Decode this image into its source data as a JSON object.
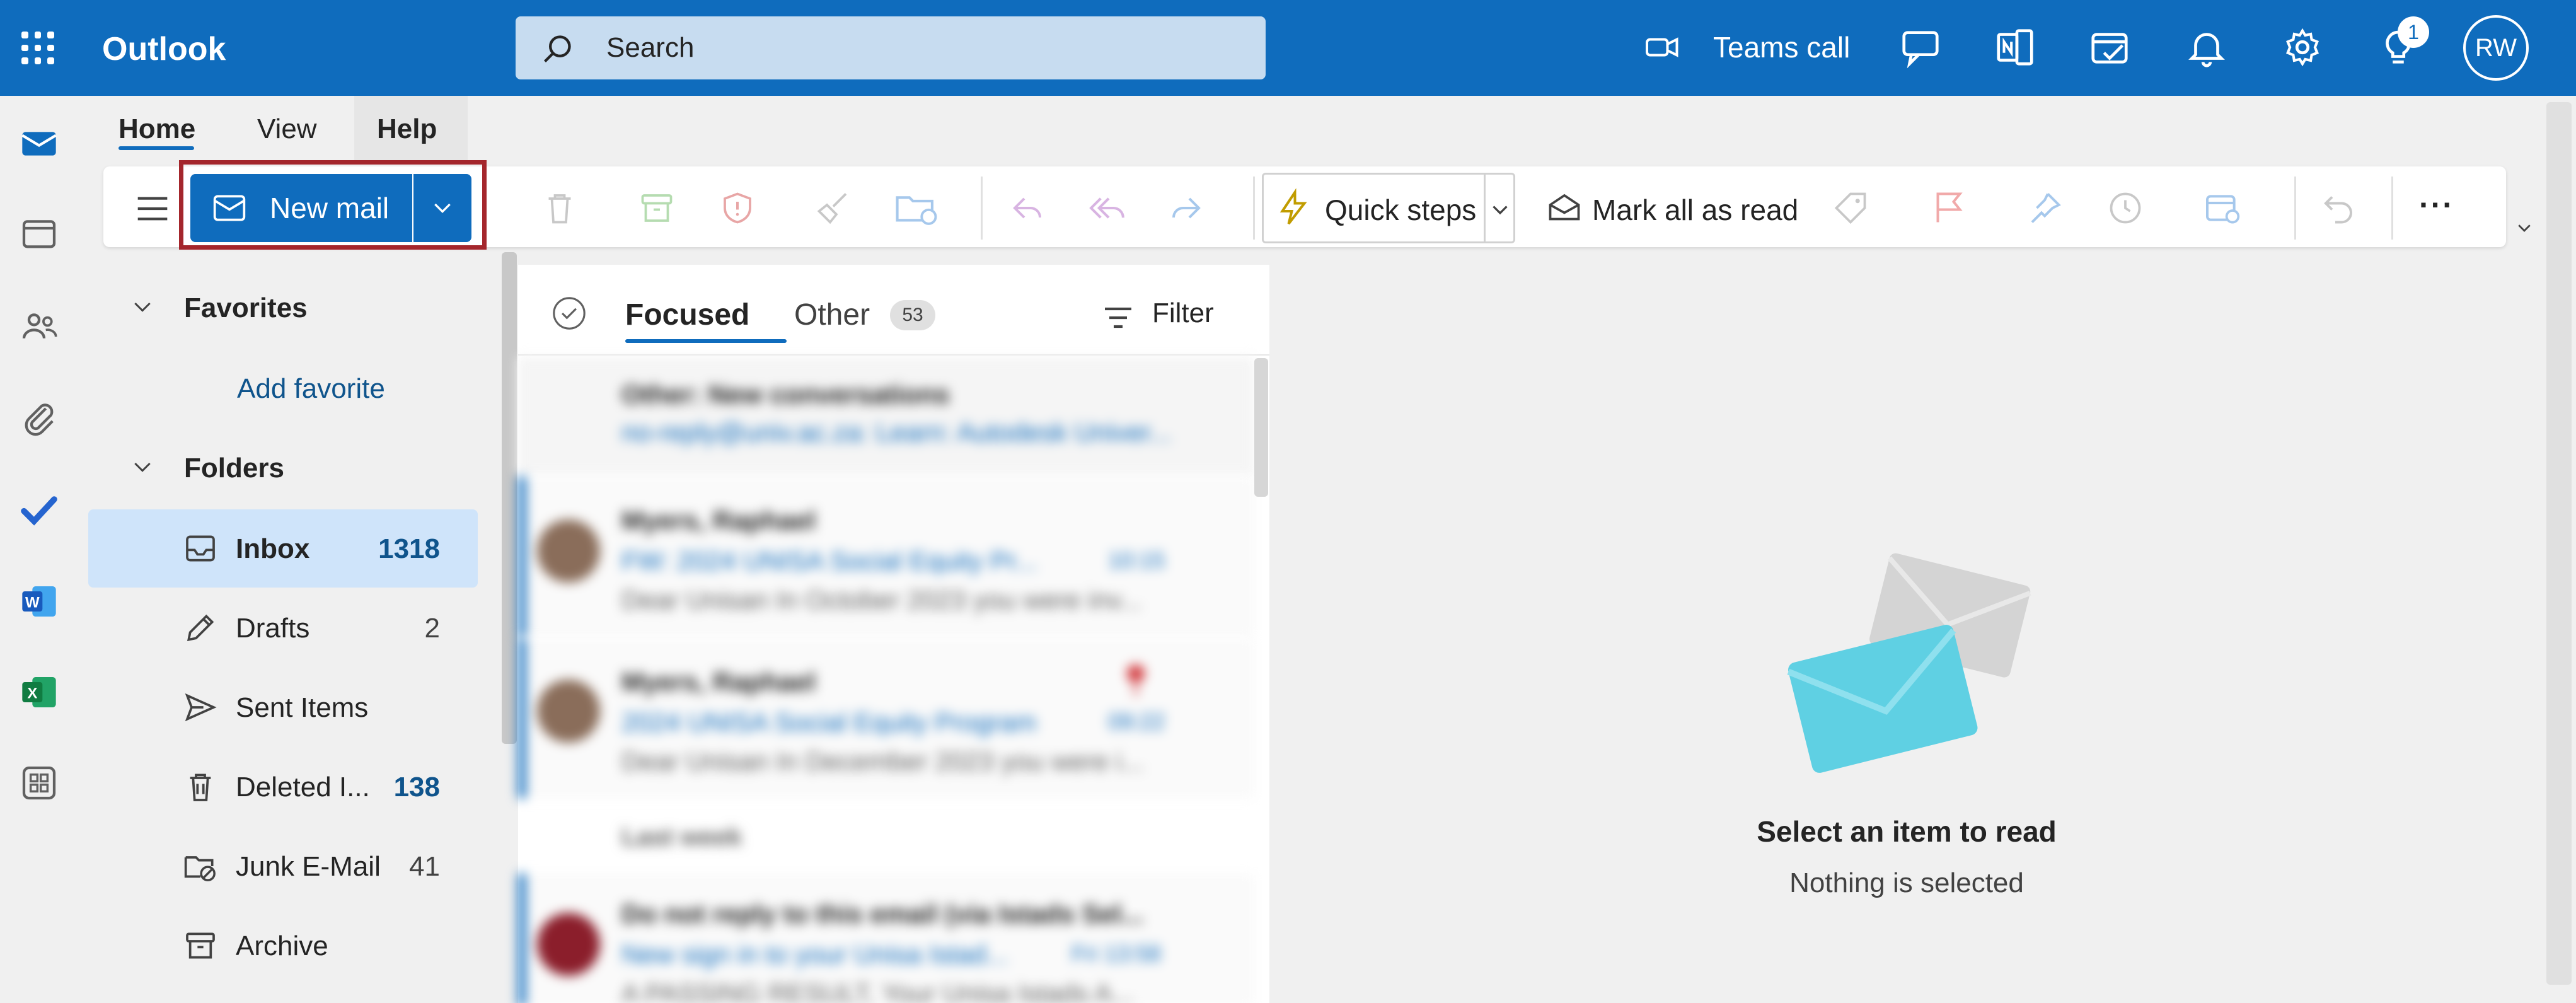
{
  "app": {
    "name": "Outlook"
  },
  "search": {
    "placeholder": "Search"
  },
  "topbar": {
    "teams_call": "Teams call",
    "tips_count": "1",
    "avatar_initials": "RW"
  },
  "ribbon": {
    "tabs": [
      {
        "label": "Home"
      },
      {
        "label": "View"
      },
      {
        "label": "Help"
      }
    ],
    "new_mail": "New mail",
    "quick_steps": "Quick steps",
    "mark_all_read": "Mark all as read",
    "more": "···"
  },
  "folder_pane": {
    "favorites": "Favorites",
    "add_favorite": "Add favorite",
    "folders": "Folders",
    "items": [
      {
        "name": "Inbox",
        "count": "1318"
      },
      {
        "name": "Drafts",
        "count": "2"
      },
      {
        "name": "Sent Items",
        "count": ""
      },
      {
        "name": "Deleted I...",
        "count": "138"
      },
      {
        "name": "Junk E-Mail",
        "count": "41"
      },
      {
        "name": "Archive",
        "count": ""
      }
    ]
  },
  "message_list": {
    "focused": "Focused",
    "other": "Other",
    "other_count": "53",
    "filter": "Filter",
    "messages": [
      {
        "l1": "Other: New conversations",
        "l2": "no-reply@univ.ac.za: Learn: Autodesk Univer..."
      },
      {
        "l1": "Myers, Raphael",
        "l2": "FW: 2024 UNISA Social Equity Pr...",
        "time": "10:15",
        "l3": "Dear Unisan In October 2023 you were inv..."
      },
      {
        "l1": "Myers, Raphael",
        "l2": "2024 UNISA Social Equity Program",
        "time": "09:22",
        "l3": "Dear Unisan In December 2023 you were i..."
      },
      {
        "section": "Last week"
      },
      {
        "l1": "Do not reply to this email (via Istads Sel...",
        "l2": "New sign in to your Unisa Istad...",
        "time": "Fri 13:58",
        "l3": "A PASSING RESULT, Your Unisa Istads A..."
      }
    ]
  },
  "reading_pane": {
    "title": "Select an item to read",
    "subtitle": "Nothing is selected"
  },
  "colors": {
    "brand": "#0f6cbd",
    "highlight": "#a4262c",
    "selected_folder": "#cfe4fa"
  }
}
